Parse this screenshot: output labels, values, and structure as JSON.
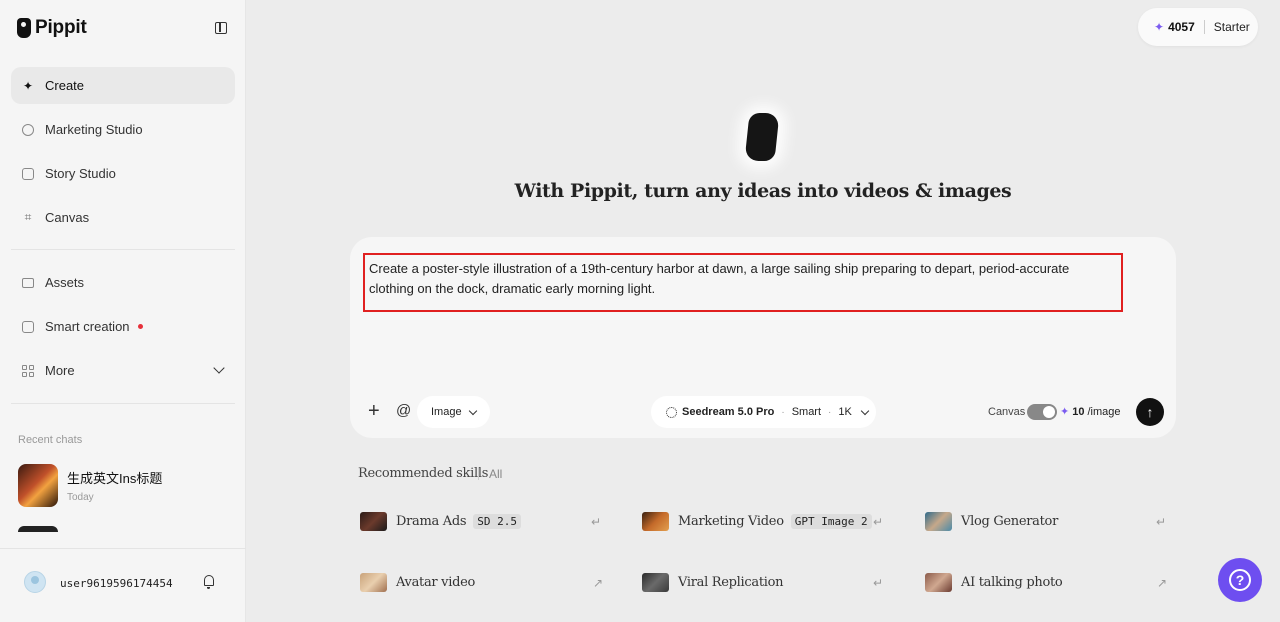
{
  "brand": {
    "name": "Pippit"
  },
  "sidebar": {
    "nav": [
      {
        "label": "Create",
        "icon": "sparkle-icon"
      },
      {
        "label": "Marketing Studio",
        "icon": "clock-icon"
      },
      {
        "label": "Story Studio",
        "icon": "play-box-icon"
      },
      {
        "label": "Canvas",
        "icon": "frame-icon"
      },
      {
        "label": "Assets",
        "icon": "folder-icon"
      },
      {
        "label": "Smart creation",
        "icon": "smart-box-icon"
      },
      {
        "label": "More",
        "icon": "grid-icon"
      }
    ],
    "recent_label": "Recent chats",
    "recent_chats": [
      {
        "title": "生成英文Ins标题",
        "time": "Today"
      }
    ],
    "user": {
      "name": "user9619596174454"
    }
  },
  "credits": {
    "count": "4057",
    "plan": "Starter"
  },
  "hero": {
    "title": "With Pippit, turn any ideas into videos & images"
  },
  "prompt": {
    "text": "Create a poster-style illustration of a 19th-century harbor at dawn, a large sailing ship preparing to depart, period-accurate clothing on the dock, dramatic early morning light.",
    "mode": "Image",
    "model": "Seedream 5.0 Pro",
    "quality": "Smart",
    "resolution": "1K",
    "canvas_label": "Canvas",
    "cost": "10",
    "cost_unit": "/image"
  },
  "skills": {
    "title": "Recommended skills",
    "all_label": "All",
    "items": [
      {
        "label": "Drama Ads",
        "tag": "SD 2.5",
        "arrow": "↵"
      },
      {
        "label": "Marketing Video",
        "tag": "GPT Image 2",
        "arrow": "↵"
      },
      {
        "label": "Vlog Generator",
        "tag": "",
        "arrow": "↵"
      },
      {
        "label": "Avatar video",
        "tag": "",
        "arrow": "↗"
      },
      {
        "label": "Viral Replication",
        "tag": "",
        "arrow": "↵"
      },
      {
        "label": "AI talking photo",
        "tag": "",
        "arrow": "↗"
      }
    ]
  },
  "colors": {
    "accent": "#7b5cf0",
    "help": "#6e4ef0",
    "highlight": "#e02020"
  }
}
